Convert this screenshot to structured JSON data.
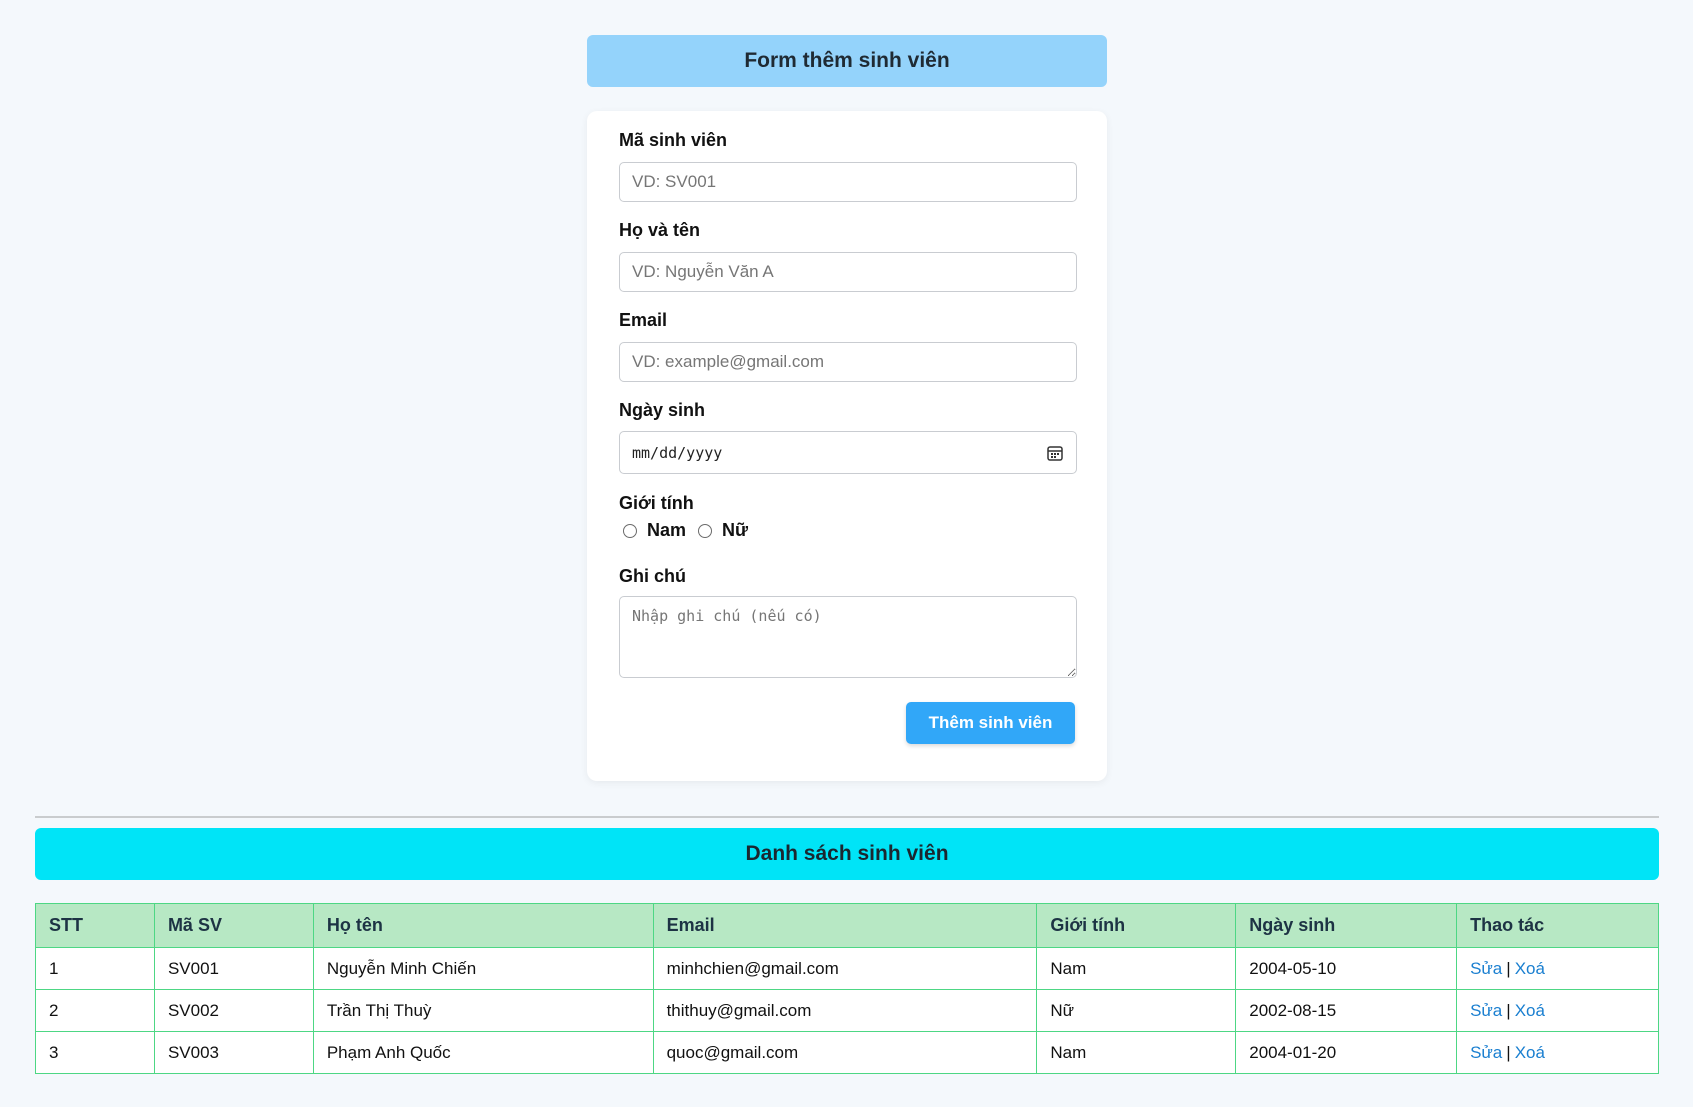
{
  "form": {
    "title": "Form thêm sinh viên",
    "student_id": {
      "label": "Mã sinh viên",
      "placeholder": "VD: SV001",
      "value": ""
    },
    "full_name": {
      "label": "Họ và tên",
      "placeholder": "VD: Nguyễn Văn A",
      "value": ""
    },
    "email": {
      "label": "Email",
      "placeholder": "VD: example@gmail.com",
      "value": ""
    },
    "birthdate": {
      "label": "Ngày sinh",
      "placeholder": "mm/dd/yyyy"
    },
    "gender": {
      "label": "Giới tính",
      "options": [
        "Nam",
        "Nữ"
      ]
    },
    "note": {
      "label": "Ghi chú",
      "placeholder": "Nhập ghi chú (nếu có)"
    },
    "submit_label": "Thêm sinh viên"
  },
  "list": {
    "title": "Danh sách sinh viên",
    "columns": [
      "STT",
      "Mã SV",
      "Họ tên",
      "Email",
      "Giới tính",
      "Ngày sinh",
      "Thao tác"
    ],
    "rows": [
      {
        "stt": "1",
        "id": "SV001",
        "name": "Nguyễn Minh Chiến",
        "email": "minhchien@gmail.com",
        "gender": "Nam",
        "dob": "2004-05-10"
      },
      {
        "stt": "2",
        "id": "SV002",
        "name": "Trần Thị Thuỳ",
        "email": "thithuy@gmail.com",
        "gender": "Nữ",
        "dob": "2002-08-15"
      },
      {
        "stt": "3",
        "id": "SV003",
        "name": "Phạm Anh Quốc",
        "email": "quoc@gmail.com",
        "gender": "Nam",
        "dob": "2004-01-20"
      }
    ],
    "actions": {
      "edit": "Sửa",
      "separator": "|",
      "delete": "Xoá"
    }
  },
  "icons": {
    "date_picker": "calendar-icon"
  },
  "colors": {
    "form_title_bg": "#94d3fb",
    "list_title_bg": "#00e4f7",
    "button_bg": "#31a7f8",
    "table_header_bg": "#b7e8c4",
    "table_border": "#4dd784",
    "link": "#1a7fd0"
  }
}
